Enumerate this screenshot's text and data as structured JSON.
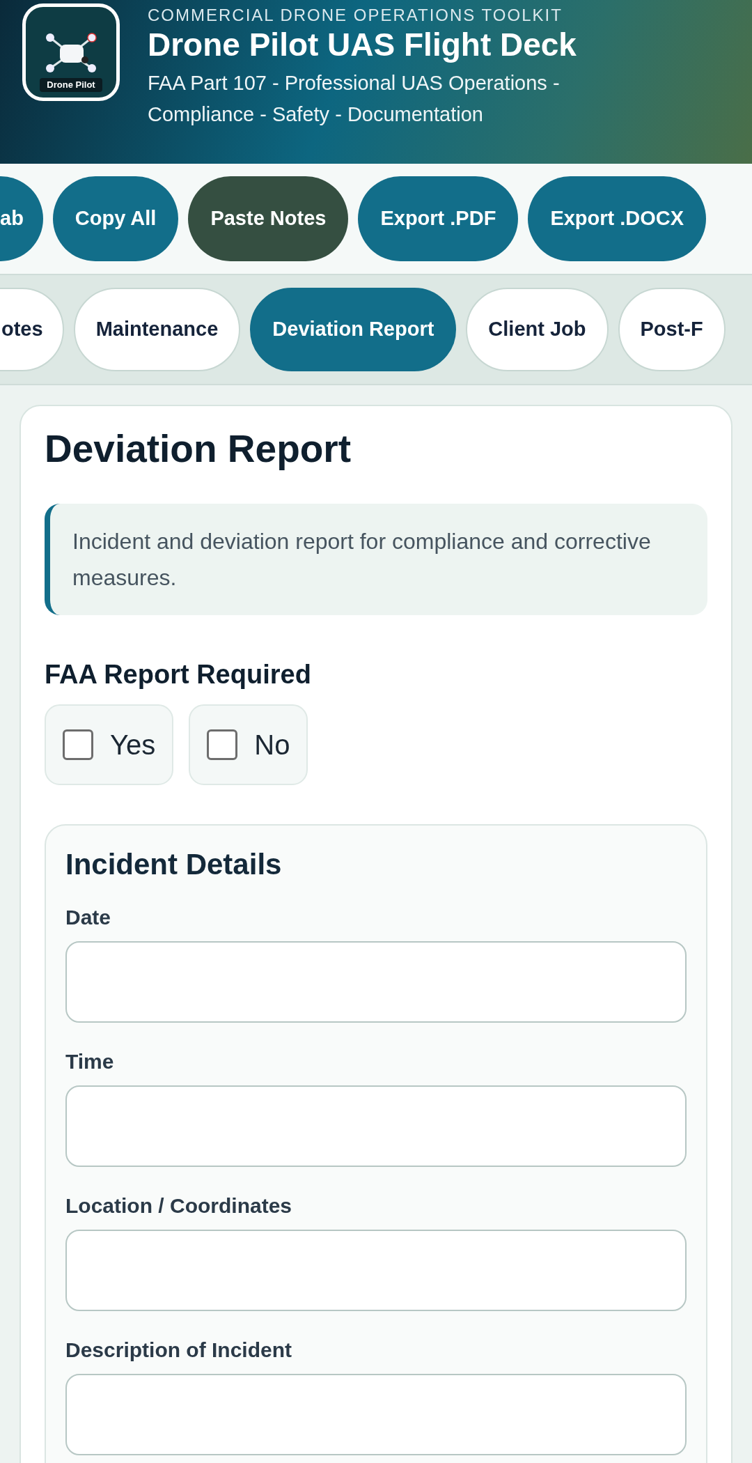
{
  "header": {
    "logo_text": "Drone Pilot",
    "kicker": "COMMERCIAL DRONE OPERATIONS TOOLKIT",
    "title": "Drone Pilot UAS Flight Deck",
    "subtitle": "FAA Part 107 - Professional UAS Operations - Compliance - Safety - Documentation"
  },
  "actions": [
    {
      "label": "ab",
      "kind": "primary"
    },
    {
      "label": "Copy All",
      "kind": "primary"
    },
    {
      "label": "Paste Notes",
      "kind": "dark"
    },
    {
      "label": "Export .PDF",
      "kind": "primary"
    },
    {
      "label": "Export .DOCX",
      "kind": "primary"
    }
  ],
  "tabs": [
    {
      "label": "otes",
      "selected": false
    },
    {
      "label": "Maintenance",
      "selected": false
    },
    {
      "label": "Deviation Report",
      "selected": true
    },
    {
      "label": "Client Job",
      "selected": false
    },
    {
      "label": "Post-F",
      "selected": false
    }
  ],
  "card": {
    "title": "Deviation Report",
    "info": "Incident and deviation report for compliance and corrective measures.",
    "faa": {
      "label": "FAA Report Required",
      "options": [
        {
          "label": "Yes",
          "checked": false
        },
        {
          "label": "No",
          "checked": false
        }
      ]
    },
    "section": {
      "title": "Incident Details",
      "fields": [
        {
          "label": "Date"
        },
        {
          "label": "Time"
        },
        {
          "label": "Location / Coordinates"
        },
        {
          "label": "Description of Incident"
        }
      ]
    }
  }
}
